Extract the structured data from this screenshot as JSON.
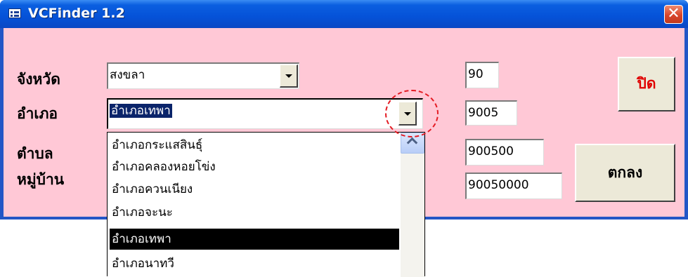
{
  "window": {
    "title": "VCFinder 1.2",
    "close_glyph": "✕",
    "app_icon": "form-icon",
    "close_icon": "close-icon"
  },
  "form": {
    "labels": {
      "province": "จังหวัด",
      "district": "อำเภอ",
      "subdistrict": "ตำบล",
      "village": "หมู่บ้าน"
    },
    "province": {
      "value": "สงขลา",
      "code": "90"
    },
    "district": {
      "value": "อำเภอเทพา",
      "code": "9005"
    },
    "subdistrict": {
      "code": "900500"
    },
    "village": {
      "code": "90050000"
    },
    "buttons": {
      "close_label": "ปิด",
      "ok_label": "ตกลง"
    }
  },
  "dropdown": {
    "items": [
      "อำเภอกระแสสินธุ์",
      "อำเภอคลองหอยโข่ง",
      "อำเภอควนเนียง",
      "อำเภอจะนะ",
      "อำเภอเทพา",
      "อำเภอนาทวี"
    ],
    "selected_index": 4,
    "scroll_icon": "chevron-up-icon"
  },
  "colors": {
    "titlebar": "#0552d8",
    "client_bg": "#ffc8d6",
    "close_label_color": "#e00000",
    "highlight_circle": "#e41b23"
  }
}
